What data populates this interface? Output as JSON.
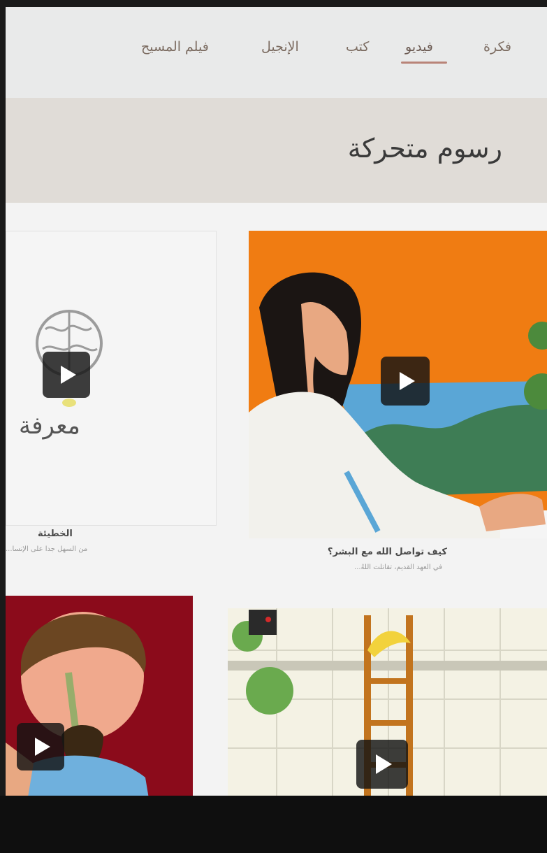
{
  "nav": {
    "items": [
      {
        "label": "فكرة"
      },
      {
        "label": "فيديو"
      },
      {
        "label": "كتب"
      },
      {
        "label": "الإنجيل"
      },
      {
        "label": "فيلم المسيح"
      }
    ],
    "active_index": 1
  },
  "banner": {
    "title": "رسوم متحركة"
  },
  "cards": [
    {
      "title": "كيف تواصل الله مع البشر؟",
      "subtitle": "في العهد القديم، تقاتلت اللهُ...",
      "theme": "jesus-orange",
      "icon": "play-icon"
    },
    {
      "logo_text": "معرفة",
      "title": "الخطيئة",
      "subtitle": "من السهل جدا على الإنسا...",
      "theme": "brain-logo",
      "icon": "play-icon"
    },
    {
      "theme": "monkey-ladder",
      "icon": "play-icon"
    },
    {
      "theme": "man-red",
      "icon": "play-icon"
    }
  ],
  "colors": {
    "accent_underline": "#b98478",
    "orange_bg": "#f07c12",
    "red_bg": "#8b0b1b",
    "play_bg": "#141414"
  }
}
